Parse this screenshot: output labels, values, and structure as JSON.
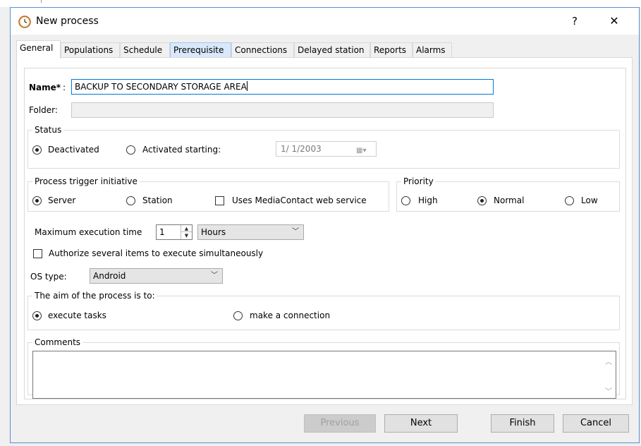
{
  "window": {
    "title": "New process",
    "help_label": "?",
    "close_label": "✕"
  },
  "tabs": [
    {
      "label": "General"
    },
    {
      "label": "Populations"
    },
    {
      "label": "Schedule"
    },
    {
      "label": "Prerequisite"
    },
    {
      "label": "Connections"
    },
    {
      "label": "Delayed station"
    },
    {
      "label": "Reports"
    },
    {
      "label": "Alarms"
    }
  ],
  "general": {
    "name_label": "Name*",
    "name_colon": ":",
    "name_value": "BACKUP TO SECONDARY STORAGE AREA",
    "folder_label": "Folder:",
    "folder_value": "",
    "status": {
      "title": "Status",
      "deactivated": "Deactivated",
      "activated": "Activated starting:",
      "date": "1/  1/2003",
      "selected": "deactivated"
    },
    "trigger": {
      "title": "Process trigger initiative",
      "server": "Server",
      "station": "Station",
      "web_service": "Uses MediaContact web service",
      "selected": "server"
    },
    "priority": {
      "title": "Priority",
      "high": "High",
      "normal": "Normal",
      "low": "Low",
      "selected": "normal"
    },
    "max_exec_label": "Maximum execution time",
    "max_exec_value": "1",
    "max_exec_unit": "Hours",
    "authorize_label": "Authorize several items to execute simultaneously",
    "os_label": "OS type:",
    "os_value": "Android",
    "aim": {
      "title": "The aim of the process is to:",
      "execute": "execute tasks",
      "connect": "make a connection",
      "selected": "execute"
    },
    "comments": {
      "title": "Comments",
      "value": ""
    }
  },
  "footer": {
    "previous": "Previous",
    "next": "Next",
    "finish": "Finish",
    "cancel": "Cancel"
  }
}
